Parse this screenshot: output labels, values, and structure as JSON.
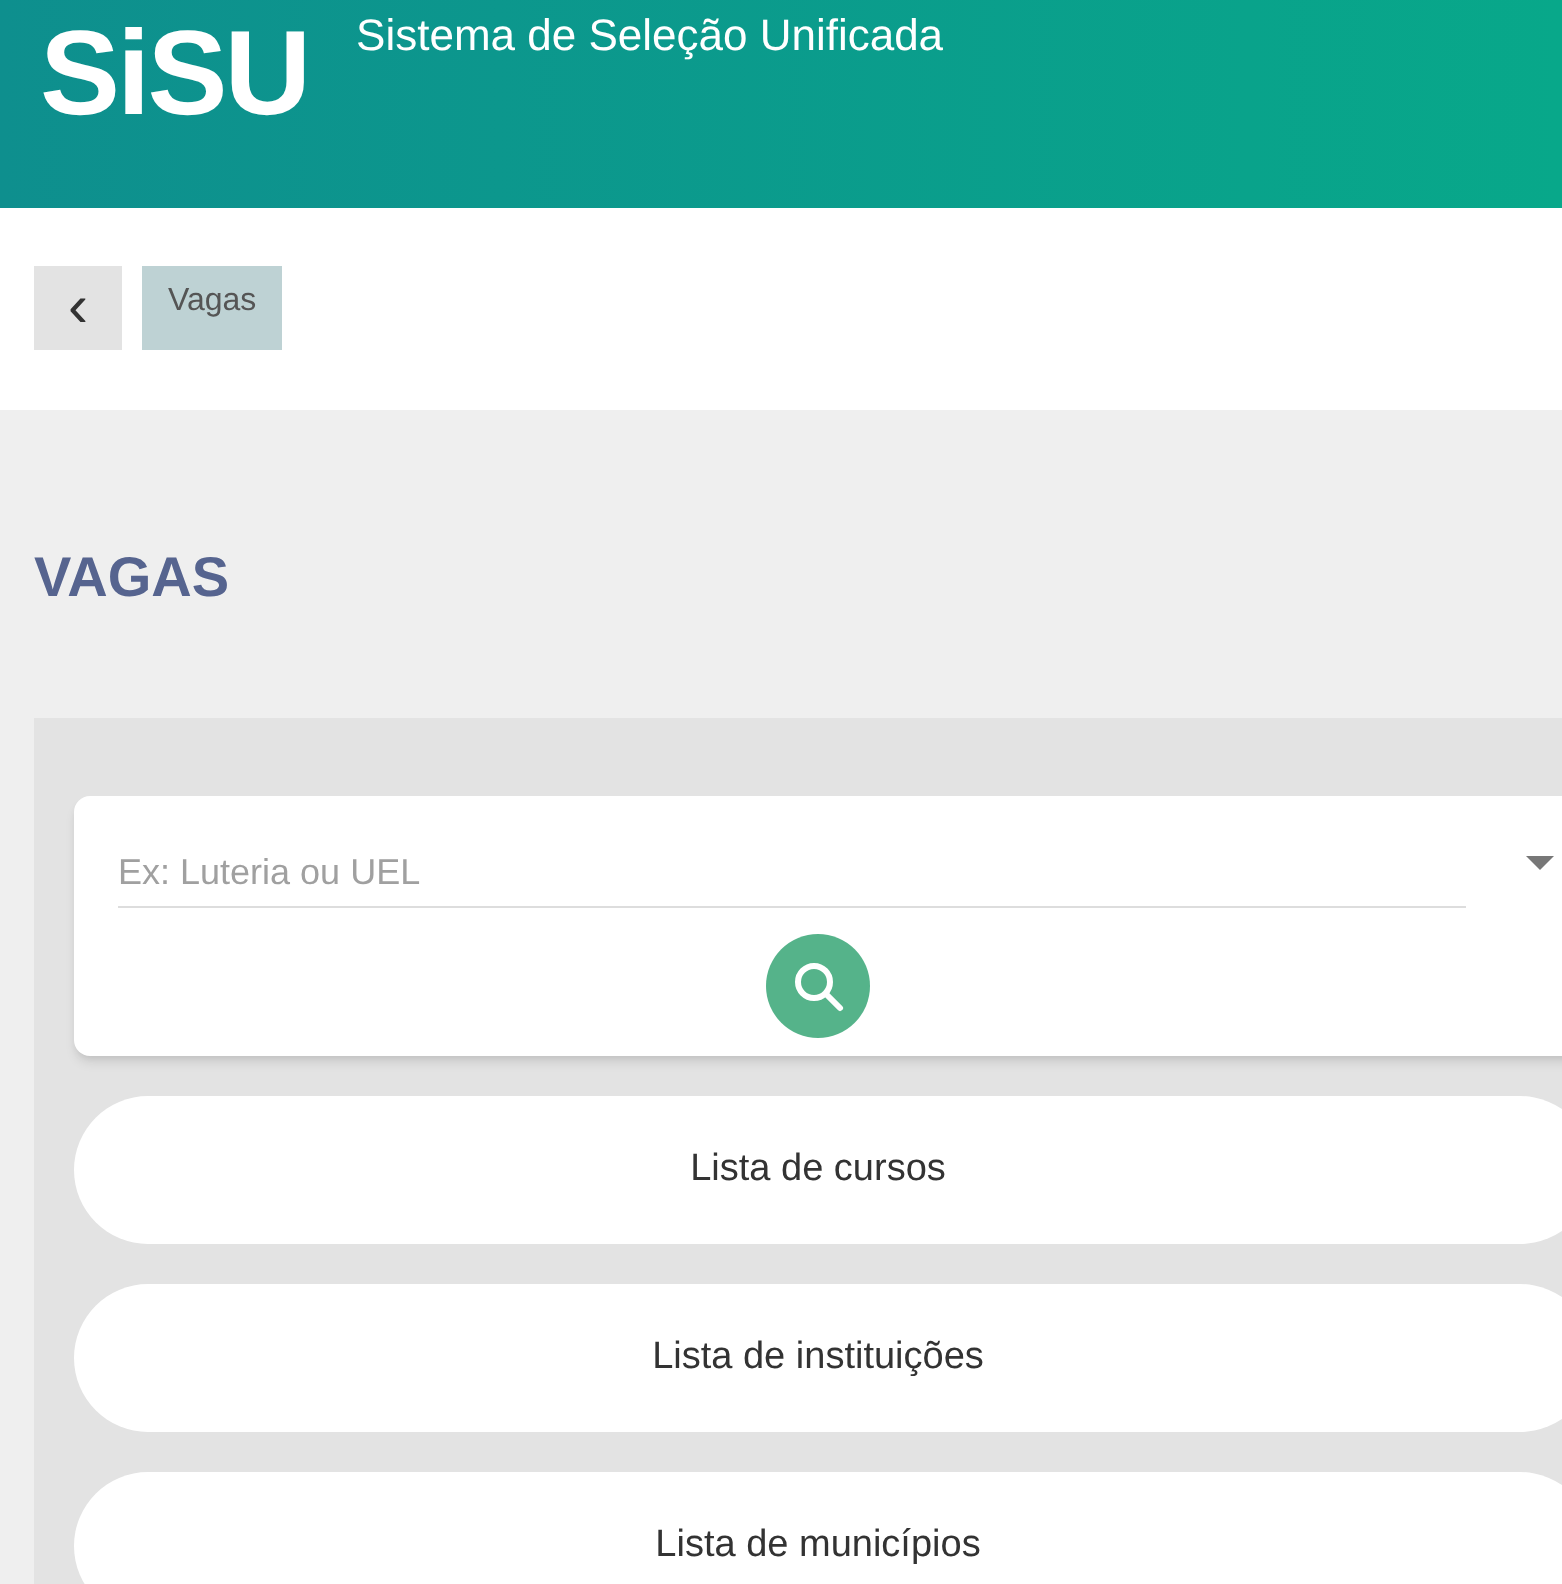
{
  "header": {
    "logo": "SiSU",
    "title": "Sistema de Seleção Unificada"
  },
  "breadcrumb": {
    "back": "‹",
    "items": [
      {
        "label": "Vagas",
        "selected": true
      }
    ]
  },
  "page_title": "VAGAS",
  "search": {
    "placeholder": "Ex: Luteria ou UEL"
  },
  "links": [
    {
      "label": "Lista de cursos"
    },
    {
      "label": "Lista de instituições"
    },
    {
      "label": "Lista de municípios"
    }
  ]
}
